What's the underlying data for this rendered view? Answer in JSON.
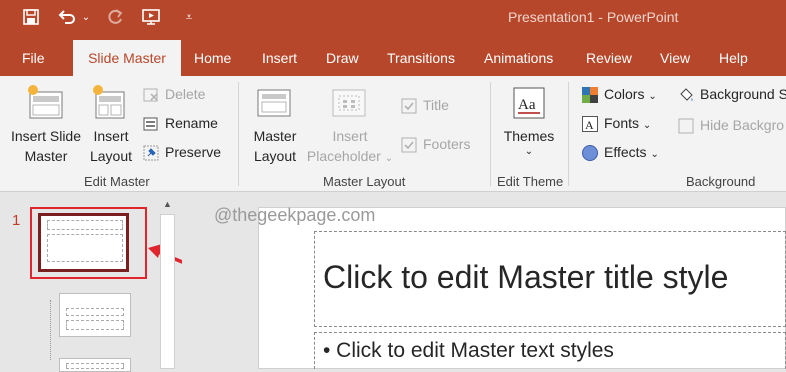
{
  "window": {
    "title": "Presentation1  -  PowerPoint"
  },
  "tabs": [
    {
      "label": "File"
    },
    {
      "label": "Slide Master"
    },
    {
      "label": "Home"
    },
    {
      "label": "Insert"
    },
    {
      "label": "Draw"
    },
    {
      "label": "Transitions"
    },
    {
      "label": "Animations"
    },
    {
      "label": "Review"
    },
    {
      "label": "View"
    },
    {
      "label": "Help"
    }
  ],
  "ribbon": {
    "edit_master": {
      "label": "Edit Master",
      "insert_slide_master": [
        "Insert Slide",
        "Master"
      ],
      "insert_layout": [
        "Insert",
        "Layout"
      ],
      "delete": "Delete",
      "rename": "Rename",
      "preserve": "Preserve"
    },
    "master_layout": {
      "label": "Master Layout",
      "master_layout_btn": [
        "Master",
        "Layout"
      ],
      "insert_placeholder": [
        "Insert",
        "Placeholder"
      ],
      "title_check": "Title",
      "footers_check": "Footers"
    },
    "edit_theme": {
      "label": "Edit Theme",
      "themes": "Themes"
    },
    "background": {
      "label": "Background",
      "colors": "Colors",
      "fonts": "Fonts",
      "effects": "Effects",
      "background_styles": "Background S",
      "hide_background": "Hide Backgro"
    }
  },
  "thumbnails": {
    "slide_number": "1"
  },
  "watermark": "@thegeekpage.com",
  "slide": {
    "title": "Click to edit Master title style",
    "body": "• Click to edit Master text styles"
  },
  "colors": {
    "accent": "#b7472a",
    "highlight": "#e0252d"
  }
}
